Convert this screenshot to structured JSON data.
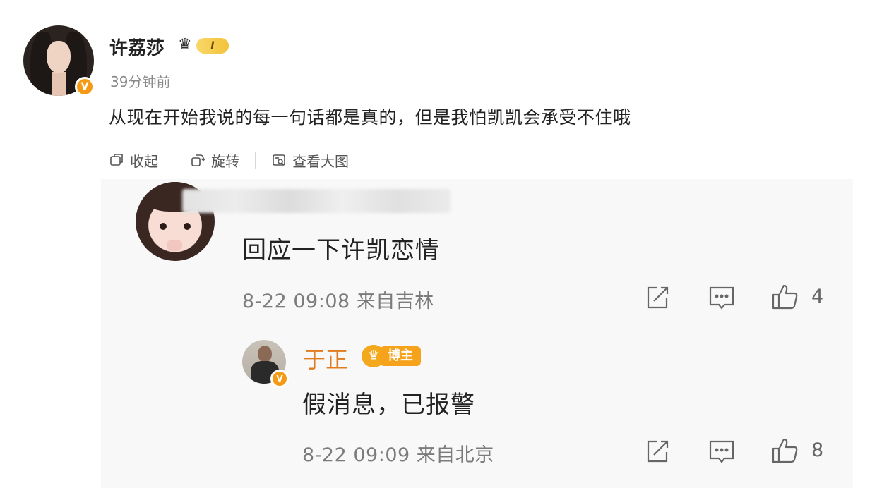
{
  "post": {
    "username": "许荔莎",
    "level_badge": "I",
    "verified_mark": "V",
    "time_ago": "39分钟前",
    "text": "从现在开始我说的每一句话都是真的，但是我怕凯凯会承受不住哦"
  },
  "toolbar": {
    "collapse_label": "收起",
    "rotate_label": "旋转",
    "view_large_label": "查看大图"
  },
  "comments": [
    {
      "text": "回应一下许凯恋情",
      "meta": "8-22 09:08  来自吉林",
      "like_count": "4"
    }
  ],
  "reply": {
    "username": "于正",
    "badge_label": "博主",
    "verified_mark": "V",
    "text": "假消息，已报警",
    "meta": "8-22 09:09  来自北京",
    "like_count": "8"
  },
  "colors": {
    "accent_orange": "#e07b1e",
    "verified": "#f59a14",
    "meta_gray": "#7b7b7b",
    "comment_bg": "#f8f8f8"
  }
}
